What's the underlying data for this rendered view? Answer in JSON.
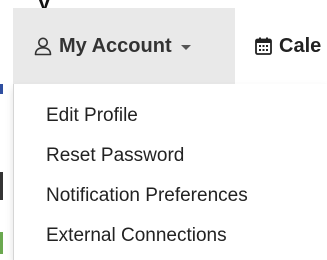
{
  "nav": {
    "account_label": "My Account",
    "account_icon": "user-icon",
    "account_caret_icon": "caret-down-icon",
    "calendar_label": "Cale",
    "calendar_icon": "calendar-icon"
  },
  "dropdown": {
    "items": [
      {
        "label": "Edit Profile"
      },
      {
        "label": "Reset Password"
      },
      {
        "label": "Notification Preferences"
      },
      {
        "label": "External Connections"
      }
    ]
  },
  "colors": {
    "nav_active_bg": "#e9e9e9",
    "text": "#222222",
    "accent_blue": "#2f4fa0",
    "accent_green": "#6aa84f"
  }
}
